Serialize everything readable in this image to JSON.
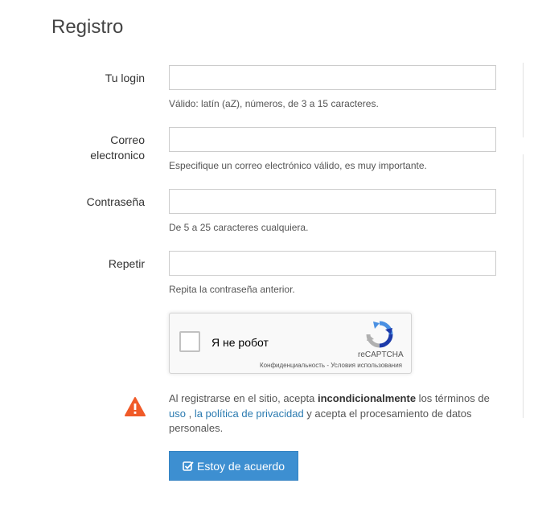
{
  "page": {
    "title": "Registro"
  },
  "fields": [
    {
      "label": "Tu login",
      "value": "",
      "hint": "Válido: latín (aZ), números, de 3 a 15 caracteres."
    },
    {
      "label_line1": "Correo",
      "label_line2": "electronico",
      "value": "",
      "hint": "Especifique un correo electrónico válido, es muy importante."
    },
    {
      "label": "Contraseña",
      "value": "",
      "hint": "De 5 a 25 caracteres cualquiera."
    },
    {
      "label": "Repetir",
      "value": "",
      "hint": "Repita la contraseña anterior."
    }
  ],
  "captcha": {
    "label": "Я не робот",
    "brand": "reCAPTCHA",
    "privacy_link": "Конфиденциальность",
    "separator": " - ",
    "terms_link": "Условия использования"
  },
  "notice": {
    "prefix": "Al registrarse en el sitio, acepta ",
    "emphasis": "incondicionalmente",
    "middle": " los términos de ",
    "link_use": "uso",
    "comma": " , ",
    "link_privacy": "la política de privacidad",
    "suffix": " y acepta el procesamiento de datos personales.",
    "icon": "warning-icon",
    "icon_color": "#f05a28"
  },
  "submit": {
    "label": "Estoy de acuerdo",
    "icon": "check-square-icon",
    "color": "#3d8fd1"
  }
}
